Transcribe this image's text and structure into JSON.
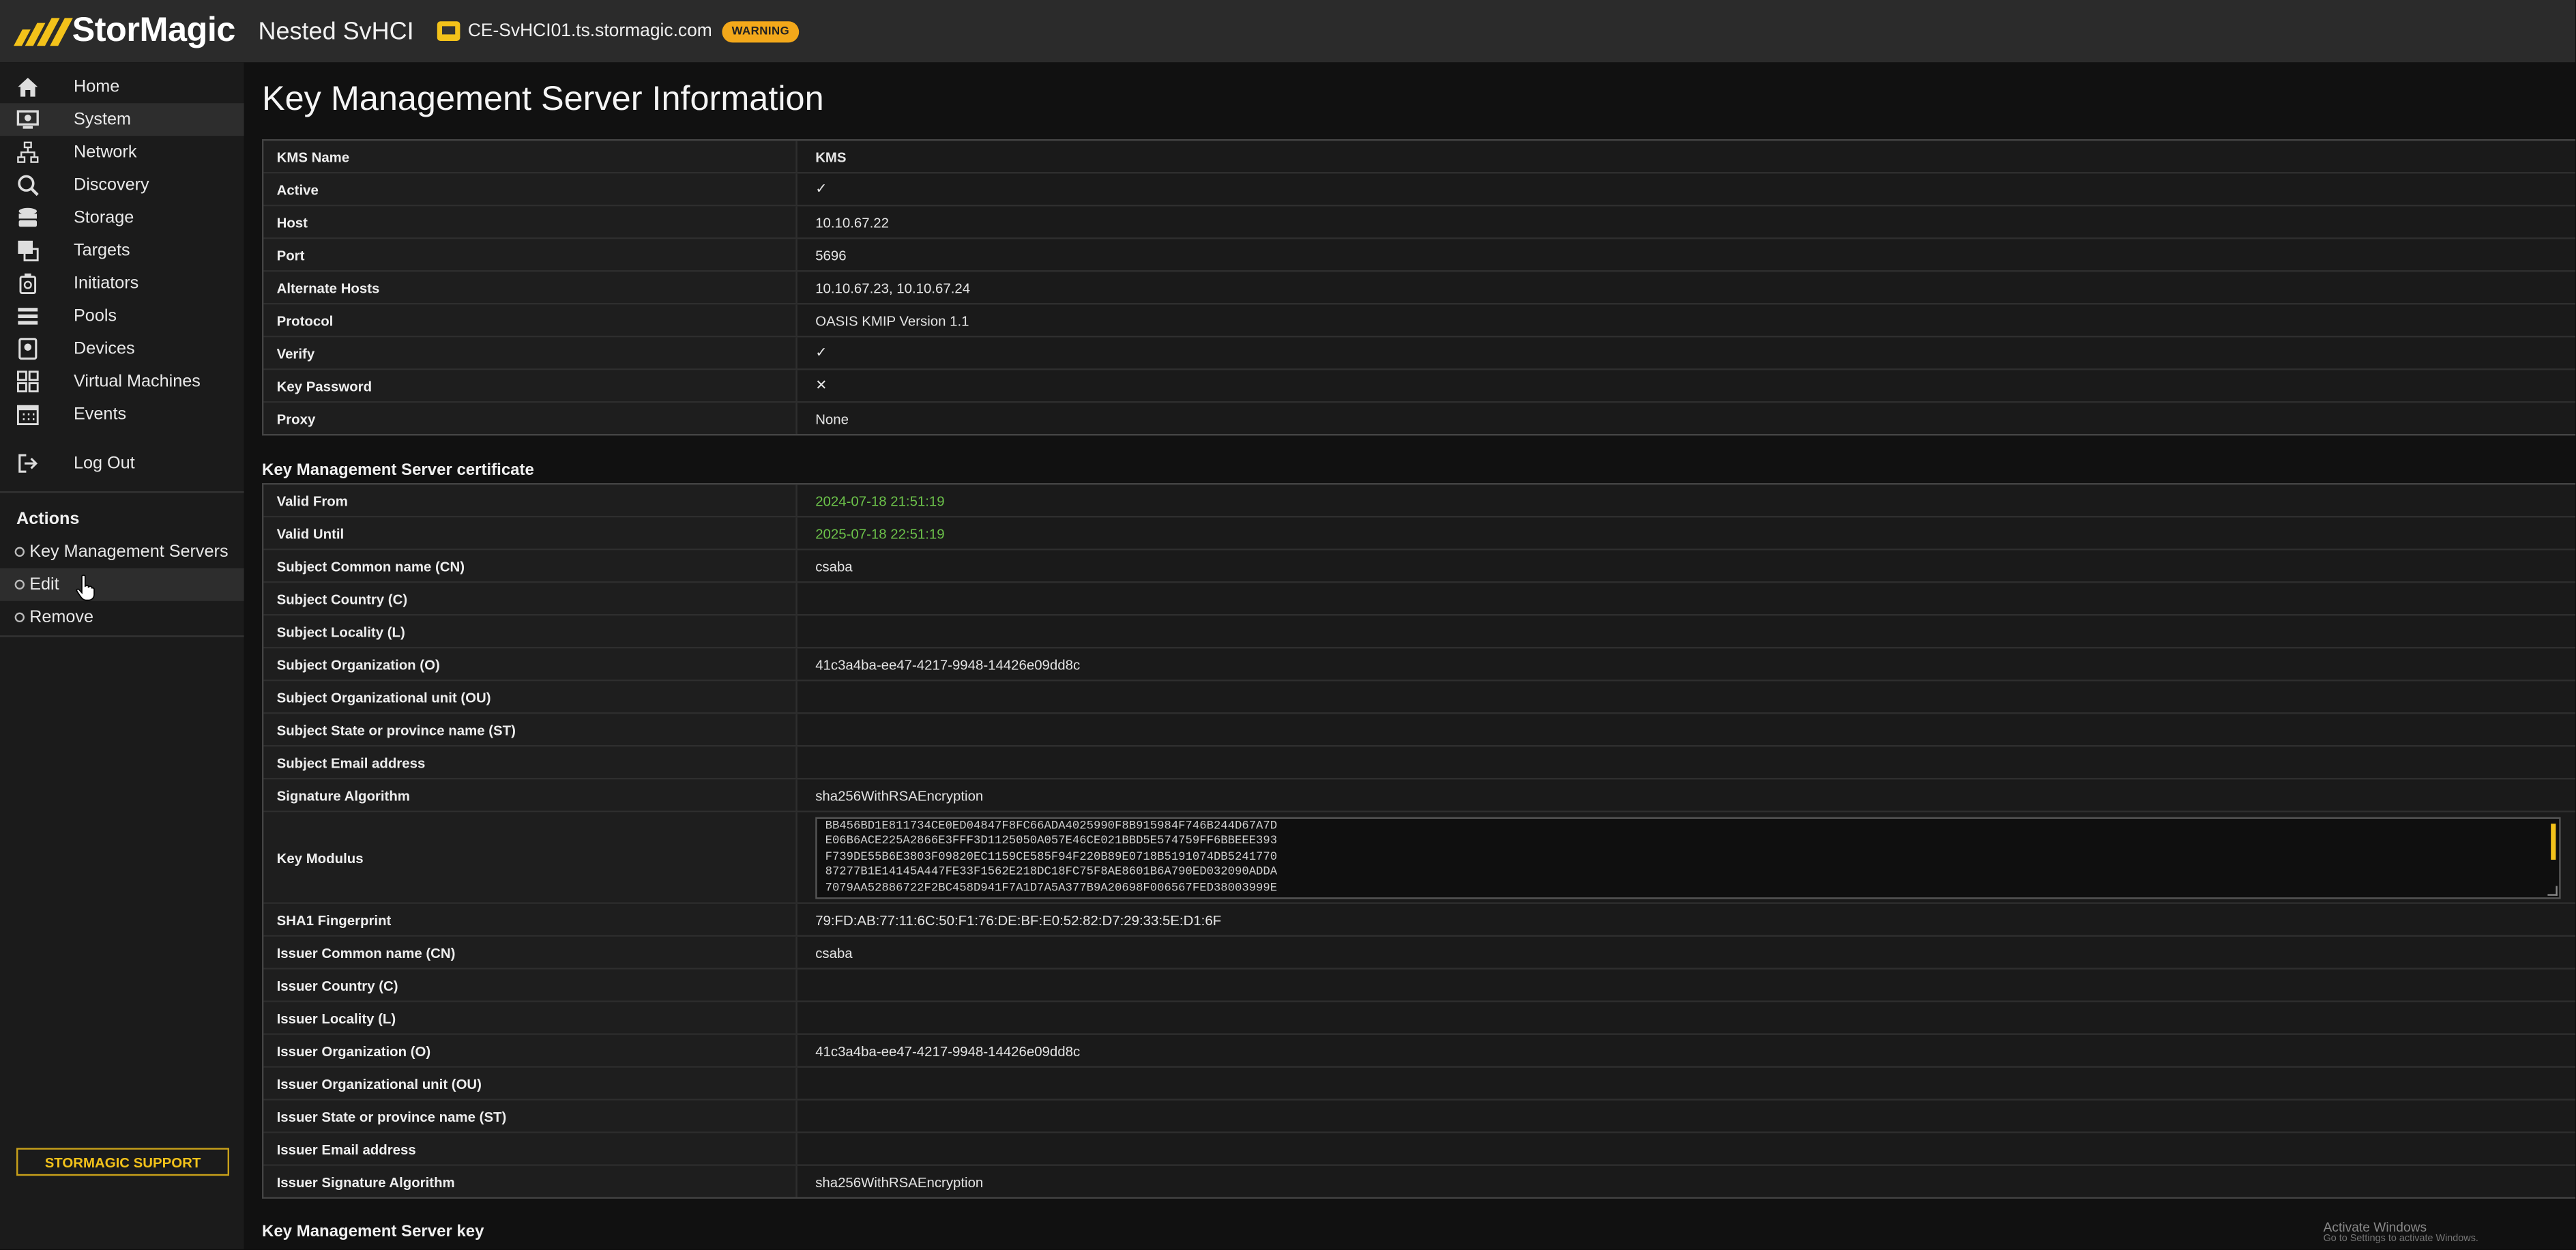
{
  "app": {
    "logo_text": "StorMagic",
    "cluster_name": "Nested SvHCI",
    "host_name": "CE-SvHCI01.ts.stormagic.com",
    "status_badge": "WARNING"
  },
  "colors": {
    "accent": "#f3c21a",
    "warning": "#f3a81a",
    "valid_date": "#6cc24a"
  },
  "sidebar": {
    "items": [
      {
        "label": "Home",
        "icon": "home-icon"
      },
      {
        "label": "System",
        "icon": "system-icon"
      },
      {
        "label": "Network",
        "icon": "network-icon"
      },
      {
        "label": "Discovery",
        "icon": "discovery-icon"
      },
      {
        "label": "Storage",
        "icon": "storage-icon"
      },
      {
        "label": "Targets",
        "icon": "targets-icon"
      },
      {
        "label": "Initiators",
        "icon": "initiators-icon"
      },
      {
        "label": "Pools",
        "icon": "pools-icon"
      },
      {
        "label": "Devices",
        "icon": "devices-icon"
      },
      {
        "label": "Virtual Machines",
        "icon": "virtual-machines-icon"
      },
      {
        "label": "Events",
        "icon": "events-icon"
      }
    ],
    "logout_label": "Log Out",
    "actions_heading": "Actions",
    "actions": [
      {
        "label": "Key Management Servers"
      },
      {
        "label": "Edit"
      },
      {
        "label": "Remove"
      }
    ],
    "support_label": "STORMAGIC SUPPORT"
  },
  "main": {
    "title": "Key Management Server Information",
    "info_rows": [
      {
        "key": "KMS Name",
        "value": "KMS"
      },
      {
        "key": "Active",
        "value": "✓"
      },
      {
        "key": "Host",
        "value": "10.10.67.22"
      },
      {
        "key": "Port",
        "value": "5696"
      },
      {
        "key": "Alternate Hosts",
        "value": "10.10.67.23, 10.10.67.24"
      },
      {
        "key": "Protocol",
        "value": "OASIS KMIP Version 1.1"
      },
      {
        "key": "Verify",
        "value": "✓"
      },
      {
        "key": "Key Password",
        "value": "✕"
      },
      {
        "key": "Proxy",
        "value": "None"
      }
    ],
    "cert_heading": "Key Management Server certificate",
    "cert_rows_top": [
      {
        "key": "Valid From",
        "value": "2024-07-18 21:51:19"
      },
      {
        "key": "Valid Until",
        "value": "2025-07-18 22:51:19"
      },
      {
        "key": "Subject Common name (CN)",
        "value": "csaba"
      },
      {
        "key": "Subject Country (C)",
        "value": ""
      },
      {
        "key": "Subject Locality (L)",
        "value": ""
      },
      {
        "key": "Subject Organization (O)",
        "value": "41c3a4ba-ee47-4217-9948-14426e09dd8c"
      },
      {
        "key": "Subject Organizational unit (OU)",
        "value": ""
      },
      {
        "key": "Subject State or province name (ST)",
        "value": ""
      },
      {
        "key": "Subject Email address",
        "value": ""
      },
      {
        "key": "Signature Algorithm",
        "value": "sha256WithRSAEncryption"
      }
    ],
    "key_modulus_label": "Key Modulus",
    "key_modulus_value": "BB456BD1E811734CE0ED04847F8FC66ADA4025990F8B915984F746B244D67A7D\nE06B6ACE225A2866E3FFF3D1125050A057E46CE021BBD5E574759FF6BBEEE393\nF739DE55B6E3803F09820EC1159CE585F94F220B89E0718B5191074DB5241770\n87277B1E14145A447FE33F1562E218DC18FC75F8AE8601B6A790ED032090ADDA\n7079AA52886722F2BC458D941F7A1D7A5A377B9A20698F006567FED38003999E",
    "cert_rows_bottom": [
      {
        "key": "SHA1 Fingerprint",
        "value": "79:FD:AB:77:11:6C:50:F1:76:DE:BF:E0:52:82:D7:29:33:5E:D1:6F"
      },
      {
        "key": "Issuer Common name (CN)",
        "value": "csaba"
      },
      {
        "key": "Issuer Country (C)",
        "value": ""
      },
      {
        "key": "Issuer Locality (L)",
        "value": ""
      },
      {
        "key": "Issuer Organization (O)",
        "value": "41c3a4ba-ee47-4217-9948-14426e09dd8c"
      },
      {
        "key": "Issuer Organizational unit (OU)",
        "value": ""
      },
      {
        "key": "Issuer State or province name (ST)",
        "value": ""
      },
      {
        "key": "Issuer Email address",
        "value": ""
      },
      {
        "key": "Issuer Signature Algorithm",
        "value": "sha256WithRSAEncryption"
      }
    ],
    "key_heading": "Key Management Server key"
  },
  "watermark": {
    "title": "Activate Windows",
    "subtitle": "Go to Settings to activate Windows."
  }
}
